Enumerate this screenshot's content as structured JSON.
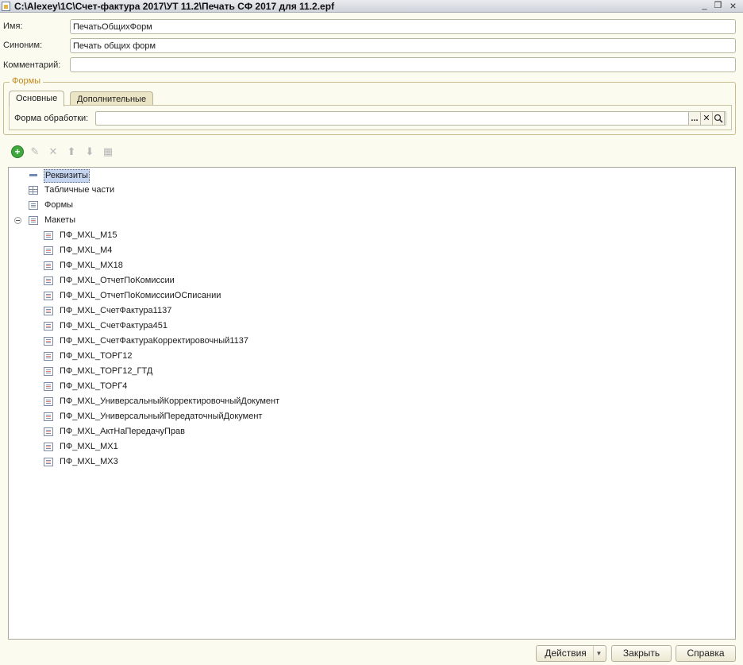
{
  "window": {
    "title": "C:\\Alexey\\1C\\Счет-фактура 2017\\УТ 11.2\\Печать СФ 2017 для 11.2.epf",
    "minimize": "_",
    "restore": "❐",
    "close": "×"
  },
  "fields": {
    "name_label": "Имя:",
    "name_value": "ПечатьОбщихФорм",
    "synonym_label": "Синоним:",
    "synonym_value": "Печать общих форм",
    "comment_label": "Комментарий:",
    "comment_value": ""
  },
  "forms_group": {
    "caption": "Формы",
    "tabs": [
      {
        "label": "Основные",
        "active": true
      },
      {
        "label": "Дополнительные",
        "active": false
      }
    ],
    "processing_form_label": "Форма обработки:",
    "processing_form_value": "",
    "select_button": "...",
    "clear_button": "✕",
    "open_button": "🔍"
  },
  "toolbar": {
    "icons": [
      "add-icon",
      "edit-icon",
      "delete-icon",
      "move-up-icon",
      "move-down-icon",
      "list-icon"
    ]
  },
  "tree": {
    "attributes": "Реквизиты",
    "tabular_sections": "Табличные части",
    "forms": "Формы",
    "layouts": "Макеты",
    "layout_items": [
      "ПФ_MXL_М15",
      "ПФ_MXL_М4",
      "ПФ_MXL_МХ18",
      "ПФ_MXL_ОтчетПоКомиссии",
      "ПФ_MXL_ОтчетПоКомиссииОСписании",
      "ПФ_MXL_СчетФактура1137",
      "ПФ_MXL_СчетФактура451",
      "ПФ_MXL_СчетФактураКорректировочный1137",
      "ПФ_MXL_ТОРГ12",
      "ПФ_MXL_ТОРГ12_ГТД",
      "ПФ_MXL_ТОРГ4",
      "ПФ_MXL_УниверсальныйКорректировочныйДокумент",
      "ПФ_MXL_УниверсальныйПередаточныйДокумент",
      "ПФ_MXL_АктНаПередачуПрав",
      "ПФ_MXL_МХ1",
      "ПФ_MXL_МХ3"
    ]
  },
  "buttons": {
    "actions": "Действия",
    "actions_arrow": "▼",
    "close": "Закрыть",
    "help": "Справка"
  }
}
